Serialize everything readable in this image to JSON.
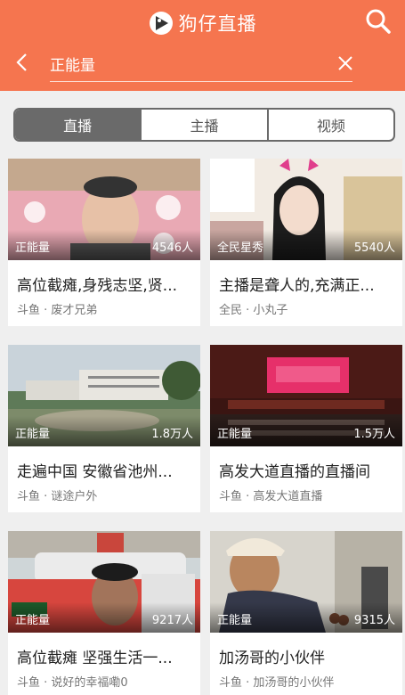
{
  "app": {
    "title": "狗仔直播"
  },
  "search": {
    "value": "正能量"
  },
  "tabs": [
    {
      "label": "直播",
      "active": true
    },
    {
      "label": "主播",
      "active": false
    },
    {
      "label": "视频",
      "active": false
    }
  ],
  "colors": {
    "header": "#f5754f",
    "tab_active": "#6a6a6a"
  },
  "cards": [
    {
      "category": "正能量",
      "viewers": "4546人",
      "title": "高位截瘫,身残志坚,贤...",
      "platform": "斗鱼",
      "anchor": "废才兄弟"
    },
    {
      "category": "全民星秀",
      "viewers": "5540人",
      "title": "主播是聋人的,充满正...",
      "platform": "全民",
      "anchor": "小丸子"
    },
    {
      "category": "正能量",
      "viewers": "1.8万人",
      "title": "走遍中国 安徽省池州...",
      "platform": "斗鱼",
      "anchor": "谜途户外"
    },
    {
      "category": "正能量",
      "viewers": "1.5万人",
      "title": "高发大道直播的直播间",
      "platform": "斗鱼",
      "anchor": "高发大道直播"
    },
    {
      "category": "正能量",
      "viewers": "9217人",
      "title": "高位截瘫 坚强生活一...",
      "platform": "斗鱼",
      "anchor": "说好的幸福嘞0"
    },
    {
      "category": "正能量",
      "viewers": "9315人",
      "title": "加汤哥的小伙伴",
      "platform": "斗鱼",
      "anchor": "加汤哥的小伙伴"
    }
  ]
}
